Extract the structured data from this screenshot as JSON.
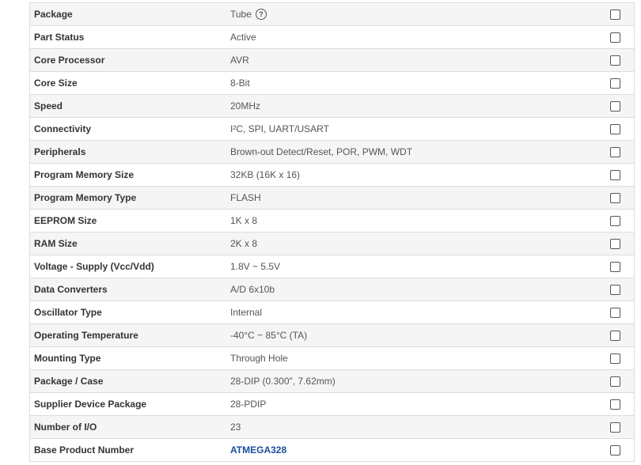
{
  "rows": [
    {
      "label": "Package",
      "value": "Tube",
      "help": "?"
    },
    {
      "label": "Part Status",
      "value": "Active"
    },
    {
      "label": "Core Processor",
      "value": "AVR"
    },
    {
      "label": "Core Size",
      "value": "8-Bit"
    },
    {
      "label": "Speed",
      "value": "20MHz"
    },
    {
      "label": "Connectivity",
      "value": "I²C, SPI, UART/USART"
    },
    {
      "label": "Peripherals",
      "value": "Brown-out Detect/Reset, POR, PWM, WDT"
    },
    {
      "label": "Program Memory Size",
      "value": "32KB (16K x 16)"
    },
    {
      "label": "Program Memory Type",
      "value": "FLASH"
    },
    {
      "label": "EEPROM Size",
      "value": "1K x 8"
    },
    {
      "label": "RAM Size",
      "value": "2K x 8"
    },
    {
      "label": "Voltage - Supply (Vcc/Vdd)",
      "value": "1.8V ~ 5.5V"
    },
    {
      "label": "Data Converters",
      "value": "A/D 6x10b"
    },
    {
      "label": "Oscillator Type",
      "value": "Internal"
    },
    {
      "label": "Operating Temperature",
      "value": "-40°C ~ 85°C (TA)"
    },
    {
      "label": "Mounting Type",
      "value": "Through Hole"
    },
    {
      "label": "Package / Case",
      "value": "28-DIP (0.300\", 7.62mm)"
    },
    {
      "label": "Supplier Device Package",
      "value": "28-PDIP"
    },
    {
      "label": "Number of I/O",
      "value": "23"
    },
    {
      "label": "Base Product Number",
      "value": "ATMEGA328"
    }
  ],
  "colors": {
    "link": "#1a4fa0",
    "alt_row": "#f5f5f5",
    "border": "#dcdcdc"
  }
}
